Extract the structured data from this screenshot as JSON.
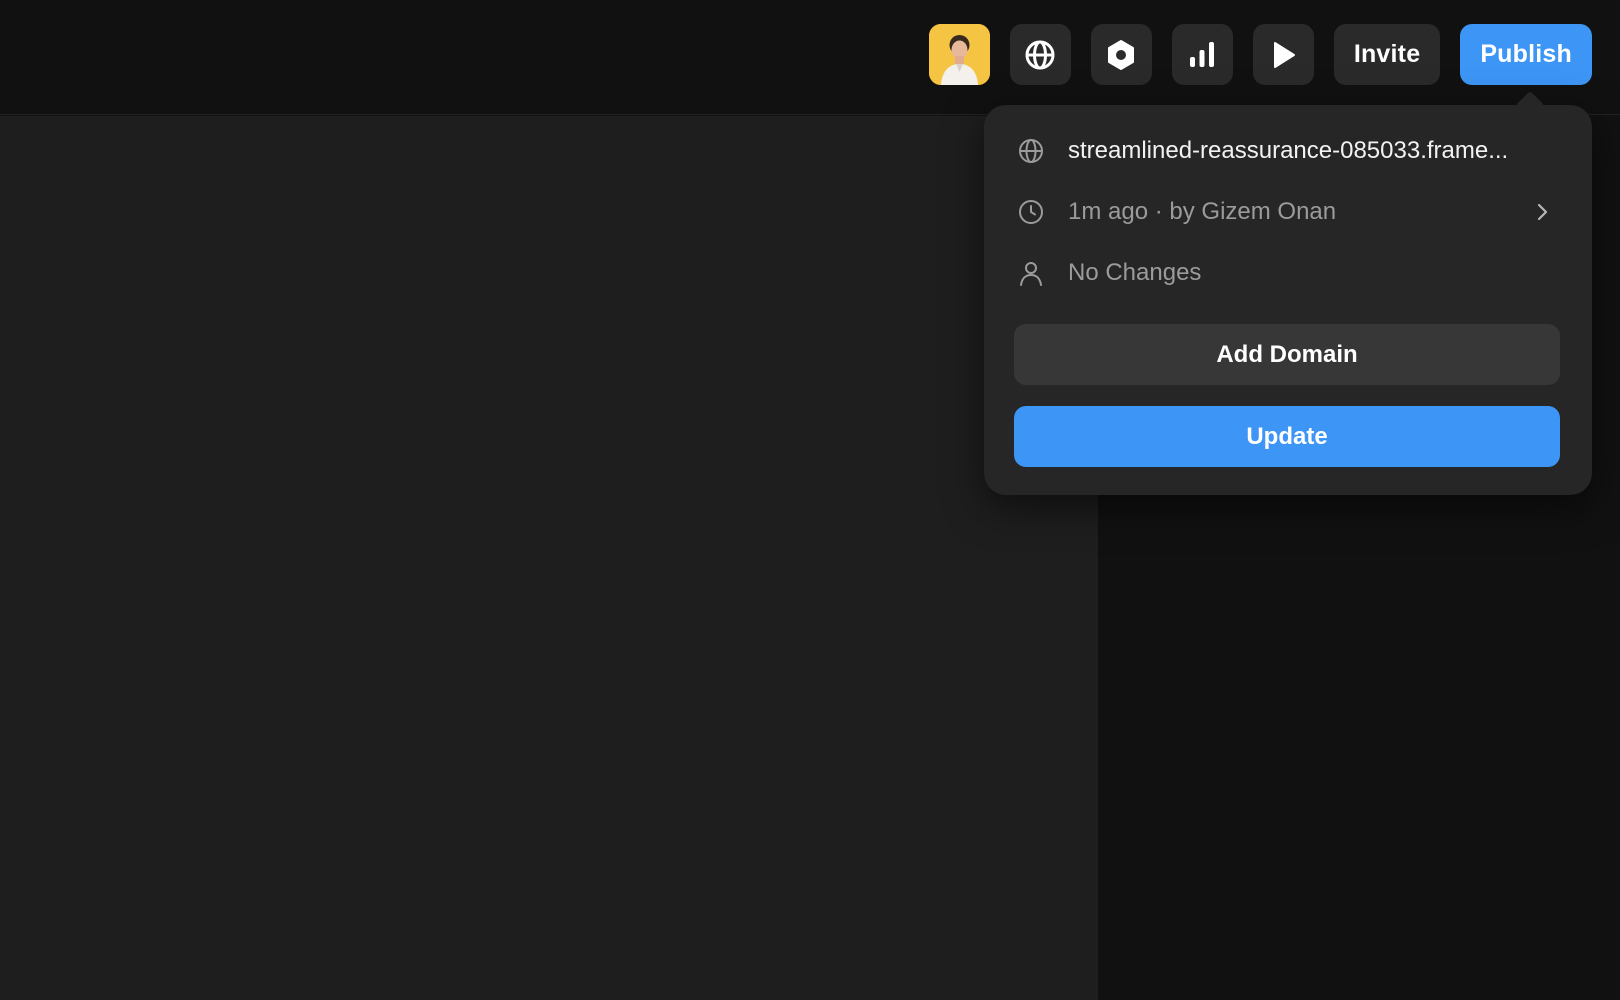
{
  "toolbar": {
    "avatar_icon": "user-avatar",
    "globe_icon": "globe-icon",
    "settings_icon": "hexagon-settings-icon",
    "analytics_icon": "bar-chart-icon",
    "preview_icon": "play-icon",
    "invite_label": "Invite",
    "publish_label": "Publish"
  },
  "popover": {
    "url": "streamlined-reassurance-085033.frame...",
    "last_update": "1m ago · by Gizem Onan",
    "changes": "No Changes",
    "add_domain_label": "Add Domain",
    "update_label": "Update"
  },
  "colors": {
    "accent": "#3d95f5",
    "avatar_bg": "#f5c443",
    "panel_bg": "#262626",
    "canvas_bg": "#1e1e1e"
  }
}
